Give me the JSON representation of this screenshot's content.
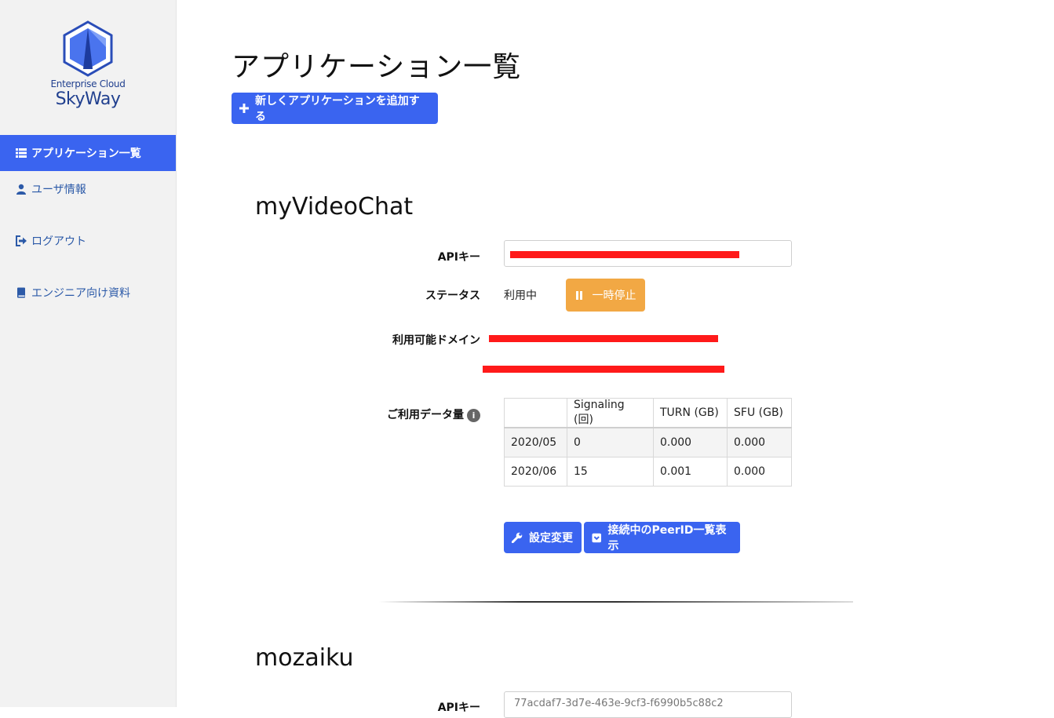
{
  "sidebar": {
    "logo_line1": "Enterprise Cloud",
    "logo_line2": "SkyWay",
    "items": [
      {
        "label": "アプリケーション一覧",
        "icon": "list-icon",
        "active": true
      },
      {
        "label": "ユーザ情報",
        "icon": "user-icon"
      },
      {
        "label": "ログアウト",
        "icon": "logout-icon"
      },
      {
        "label": "エンジニア向け資料",
        "icon": "book-icon"
      }
    ]
  },
  "main": {
    "title": "アプリケーション一覧",
    "add_button_label": "新しくアプリケーションを追加する"
  },
  "apps": [
    {
      "name": "myVideoChat",
      "api_key_label": "APIキー",
      "status_label": "ステータス",
      "status_value": "利用中",
      "pause_label": "一時停止",
      "domains_label": "利用可能ドメイン",
      "usage_label": "ご利用データ量",
      "usage_info_icon": "i",
      "usage_table": {
        "headers": [
          "",
          "Signaling (回)",
          "TURN (GB)",
          "SFU (GB)"
        ],
        "rows": [
          [
            "2020/05",
            "0",
            "0.000",
            "0.000"
          ],
          [
            "2020/06",
            "15",
            "0.001",
            "0.000"
          ]
        ]
      },
      "settings_button": "設定変更",
      "peers_button": "接続中のPeerID一覧表示"
    },
    {
      "name": "mozaiku",
      "api_key_label": "APIキー",
      "api_key": "77acdaf7-3d7e-463e-9cf3-f6990b5c88c2"
    }
  ],
  "colors": {
    "accent": "#3a64f0",
    "warning": "#f2a844",
    "redaction": "#ff1a1a"
  }
}
